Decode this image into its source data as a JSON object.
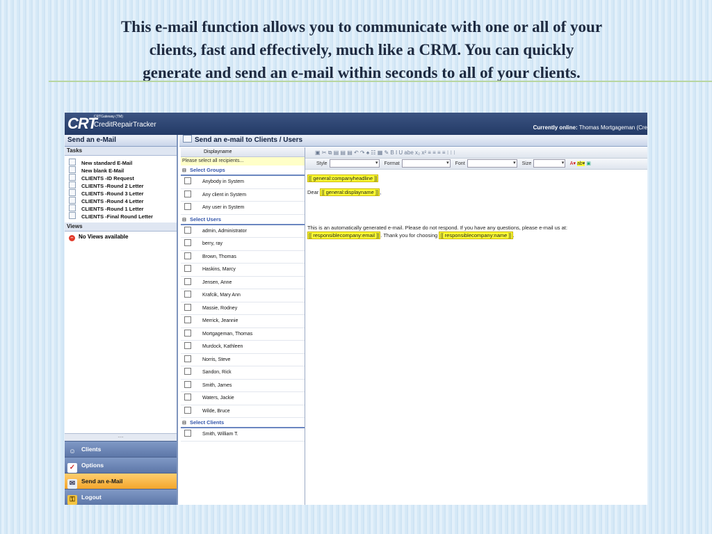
{
  "caption": {
    "line1": "This e-mail function allows you to communicate with one or all of your",
    "line2": "clients, fast and effectively, much like a CRM.  You can quickly",
    "line3": "generate and send an e-mail within seconds to all of your clients."
  },
  "app": {
    "logo": "CRT",
    "logo_sub": "CRTGateway (TM)",
    "logo_name": "CreditRepairTracker",
    "online_label": "Currently online:",
    "online_user": "Thomas Mortgageman (Cre"
  },
  "left_panel": {
    "title": "Send an e-Mail",
    "tasks_header": "Tasks",
    "tasks": [
      "New standard E-Mail",
      "New blank E-Mail",
      "CLIENTS -ID Request",
      "CLIENTS -Round 2 Letter",
      "CLIENTS -Round 3 Letter",
      "CLIENTS -Round 4 Letter",
      "CLIENTS -Round 1 Letter",
      "CLIENTS -Final Round Letter"
    ],
    "views_header": "Views",
    "no_views": "No Views available",
    "separator": ".....",
    "nav": [
      "Clients",
      "Options",
      "Send an e-Mail",
      "Logout"
    ]
  },
  "main": {
    "title": "Send an e-mail to Clients / Users",
    "list_header": "Displayname",
    "select_prompt": "Please select all recipients...",
    "groups_label": "Select Groups",
    "groups": [
      "Anybody in System",
      "Any client in System",
      "Any user in System"
    ],
    "users_label": "Select Users",
    "users": [
      "admin, Administrator",
      "berry, ray",
      "Brown, Thomas",
      "Haskins, Marcy",
      "Jensen, Anne",
      "Krafcik, Mary Ann",
      "Massie, Rodney",
      "Merrick, Jeannie",
      "Mortgageman, Thomas",
      "Murdock, Kathleen",
      "Norris, Steve",
      "Sandon, Rick",
      "Smith, James",
      "Waters, Jackie",
      "Wilde, Bruce"
    ],
    "clients_label": "Select Clients",
    "clients": [
      "Smith, William T."
    ]
  },
  "editor": {
    "toolbar1": "▣ ✂ ⧉ ▤ ▤ ▤ ↶ ↷ ♠ ☷ ▦ ✎ B I U abe x₂ x² ≡ ≡ ≡ ≡ ⁝ ⁝ ⁝",
    "style_label": "Style",
    "format_label": "Format",
    "font_label": "Font",
    "size_label": "Size",
    "headline_tag": "[[ general:companyheadline ]]",
    "dear": "Dear",
    "displayname_tag": "[[ general:displayname ]]",
    "comma": ",",
    "auto_text": "This is an automatically generated e-mail. Please do not respond. If you have any questions, please e-mail us at:",
    "email_tag": "[[ responsiblecompany:email ]]",
    "thanks_text": ". Thank you for choosing",
    "name_tag": "[[ responsiblecompany:name ]]",
    "period": "."
  }
}
